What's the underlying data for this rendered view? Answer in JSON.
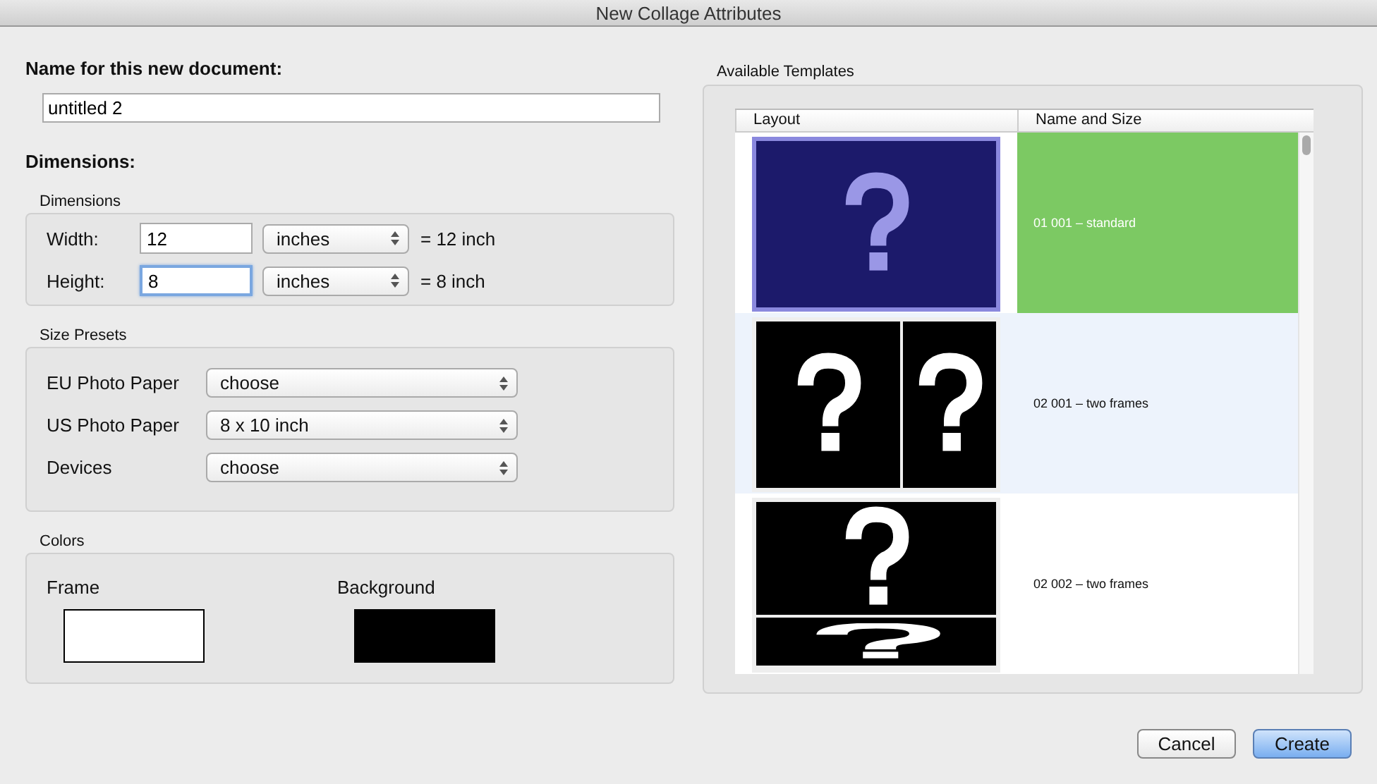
{
  "window": {
    "title": "New Collage Attributes"
  },
  "name_section": {
    "label": "Name for this new document:",
    "value": "untitled 2"
  },
  "dimensions_heading": "Dimensions:",
  "dimensions": {
    "title": "Dimensions",
    "rows": [
      {
        "label": "Width:",
        "value": "12",
        "focused": false,
        "unit": "inches",
        "result": "= 12 inch"
      },
      {
        "label": "Height:",
        "value": "8",
        "focused": true,
        "unit": "inches",
        "result": "= 8 inch"
      }
    ]
  },
  "size_presets": {
    "title": "Size Presets",
    "rows": [
      {
        "label": "EU Photo Paper",
        "value": "choose"
      },
      {
        "label": "US Photo Paper",
        "value": "8 x 10 inch"
      },
      {
        "label": "Devices",
        "value": "choose"
      }
    ]
  },
  "colors": {
    "title": "Colors",
    "items": [
      {
        "label": "Frame",
        "color": "#ffffff"
      },
      {
        "label": "Background",
        "color": "#000000"
      }
    ]
  },
  "templates": {
    "title": "Available Templates",
    "columns": [
      "Layout",
      "Name and Size"
    ],
    "rows": [
      {
        "kind": "single",
        "name": "01 001 – standard",
        "selected": true
      },
      {
        "kind": "columns",
        "name": "02 001 – two frames",
        "selected": false
      },
      {
        "kind": "rows",
        "name": "02 002 – two frames",
        "selected": false
      }
    ]
  },
  "buttons": [
    {
      "label": "Cancel",
      "default": false
    },
    {
      "label": "Create",
      "default": true
    }
  ]
}
